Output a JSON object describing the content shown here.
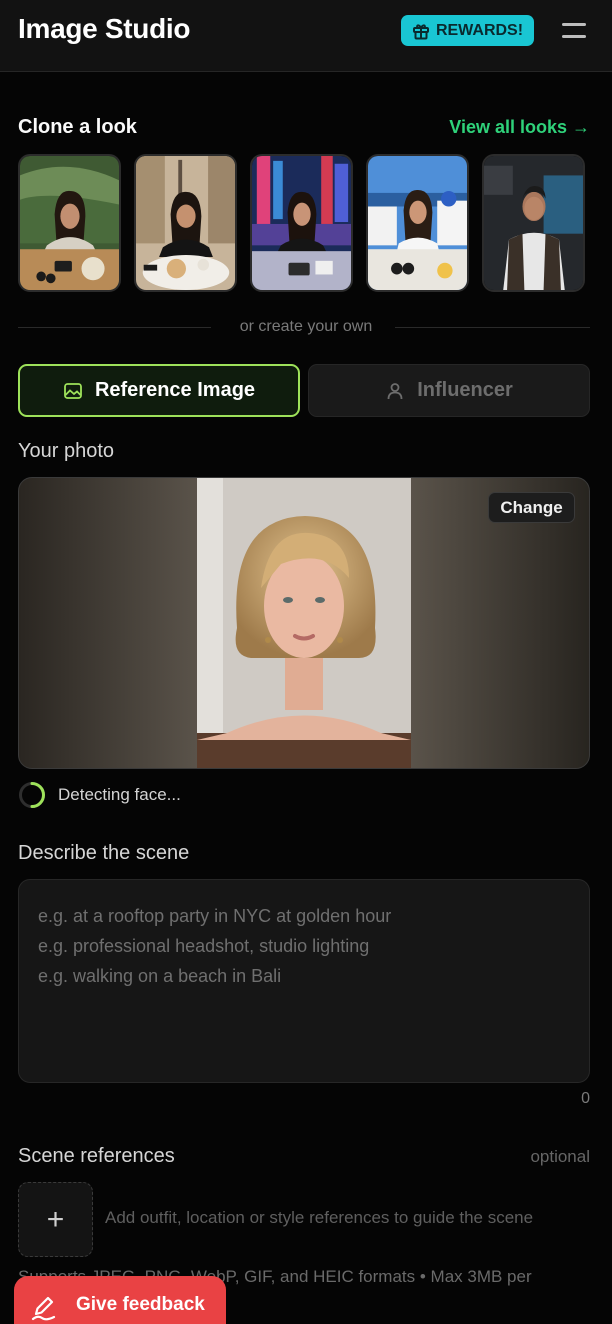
{
  "header": {
    "title": "Image Studio",
    "rewards_label": "REWARDS!",
    "rewards_icon": "gift-icon",
    "menu_icon": "hamburger-menu-icon"
  },
  "clone": {
    "title": "Clone a look",
    "view_all": "View all looks →"
  },
  "divider_text": "or create your own",
  "modes": {
    "reference": "Reference Image",
    "influencer": "Influencer"
  },
  "photo": {
    "label": "Your photo",
    "change": "Change",
    "status": "Detecting face..."
  },
  "scene": {
    "label": "Describe the scene",
    "placeholder": "e.g. at a rooftop party in NYC at golden hour\ne.g. professional headshot, studio lighting\ne.g. walking on a beach in Bali",
    "char_count": "0"
  },
  "references": {
    "label": "Scene references",
    "optional": "optional",
    "add_symbol": "+",
    "hint": "Add outfit, location or style references to guide the scene",
    "formats": "Supports JPEG, PNG, WebP, GIF, and HEIC formats • Max 3MB per"
  },
  "feedback": {
    "label": "Give feedback",
    "icon": "pen-icon"
  },
  "colors": {
    "accent_green": "#2fd27a",
    "active_border": "#9ee25a",
    "rewards_bg": "#19c6d3",
    "feedback_bg": "#e94244"
  }
}
